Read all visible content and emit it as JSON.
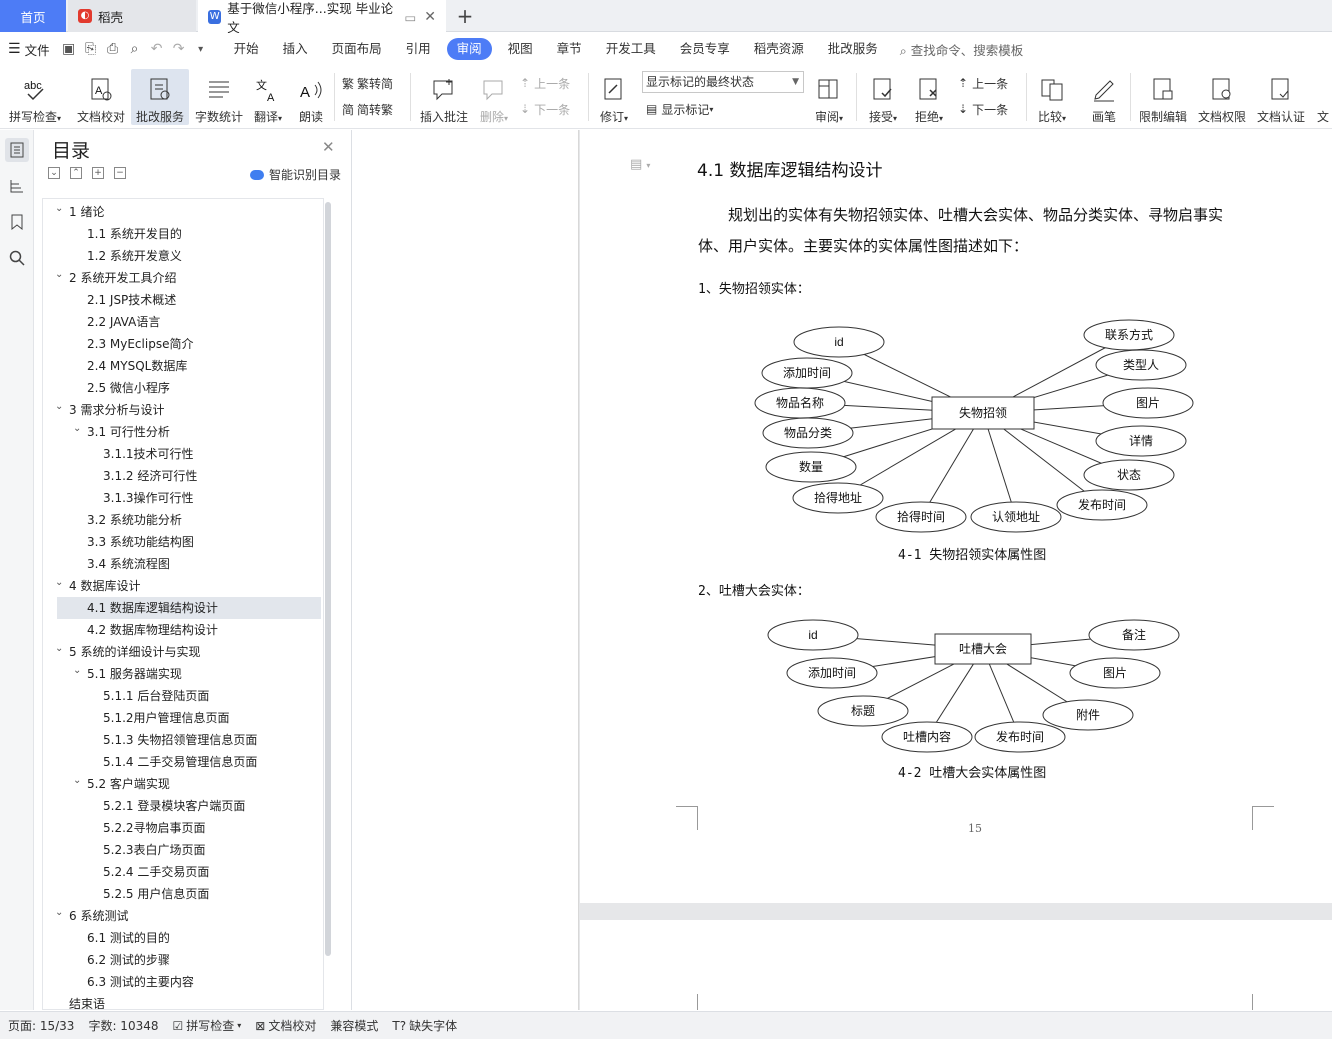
{
  "tabs": {
    "home": "首页",
    "daoke": "稻壳",
    "doc": "基于微信小程序...实现 毕业论文"
  },
  "menu": {
    "file": "文件",
    "items": [
      "开始",
      "插入",
      "页面布局",
      "引用",
      "审阅",
      "视图",
      "章节",
      "开发工具",
      "会员专享",
      "稻壳资源",
      "批改服务"
    ],
    "active": "审阅",
    "search": "查找命令、搜索模板"
  },
  "ribbon": {
    "spell": "拼写检查",
    "proof": "文档校对",
    "correct": "批改服务",
    "wordcount": "字数统计",
    "translate": "翻译",
    "read": "朗读",
    "t2s": "繁转简",
    "s2t": "简转繁",
    "add_comment": "插入批注",
    "delete": "删除",
    "prev": "上一条",
    "next": "下一条",
    "revise": "修订",
    "markup_state": "显示标记的最终状态",
    "show_markup": "显示标记",
    "review": "审阅",
    "accept": "接受",
    "reject": "拒绝",
    "prev2": "上一条",
    "next2": "下一条",
    "compare": "比较",
    "pen": "画笔",
    "restrict": "限制编辑",
    "perm": "文档权限",
    "cert": "文档认证",
    "more": "文"
  },
  "toc": {
    "title": "目录",
    "smart": "智能识别目录",
    "items": [
      {
        "label": "1  绪论",
        "level": 1,
        "arrow": "expanded"
      },
      {
        "label": "1.1  系统开发目的",
        "level": 2
      },
      {
        "label": "1.2  系统开发意义",
        "level": 2
      },
      {
        "label": "2  系统开发工具介绍",
        "level": 1,
        "arrow": "expanded"
      },
      {
        "label": "2.1 JSP技术概述",
        "level": 2
      },
      {
        "label": "2.2 JAVA语言",
        "level": 2
      },
      {
        "label": "2.3 MyEclipse简介",
        "level": 2
      },
      {
        "label": "2.4 MYSQL数据库",
        "level": 2
      },
      {
        "label": "2.5  微信小程序",
        "level": 2
      },
      {
        "label": "3  需求分析与设计",
        "level": 1,
        "arrow": "expanded"
      },
      {
        "label": "3.1  可行性分析",
        "level": 2,
        "arrow": "expanded"
      },
      {
        "label": "3.1.1技术可行性",
        "level": 3
      },
      {
        "label": "3.1.2  经济可行性",
        "level": 3
      },
      {
        "label": "3.1.3操作可行性",
        "level": 3
      },
      {
        "label": "3.2  系统功能分析",
        "level": 2
      },
      {
        "label": "3.3  系统功能结构图",
        "level": 2
      },
      {
        "label": "3.4  系统流程图",
        "level": 2
      },
      {
        "label": "4  数据库设计",
        "level": 1,
        "arrow": "expanded"
      },
      {
        "label": "4.1  数据库逻辑结构设计",
        "level": 2,
        "current": true
      },
      {
        "label": "4.2  数据库物理结构设计",
        "level": 2
      },
      {
        "label": "5  系统的详细设计与实现",
        "level": 1,
        "arrow": "expanded"
      },
      {
        "label": "5.1  服务器端实现",
        "level": 2,
        "arrow": "expanded"
      },
      {
        "label": "5.1.1  后台登陆页面",
        "level": 3
      },
      {
        "label": "5.1.2用户管理信息页面",
        "level": 3
      },
      {
        "label": "5.1.3  失物招领管理信息页面",
        "level": 3
      },
      {
        "label": "5.1.4  二手交易管理信息页面",
        "level": 3
      },
      {
        "label": "5.2  客户端实现",
        "level": 2,
        "arrow": "expanded"
      },
      {
        "label": "5.2.1  登录模块客户端页面",
        "level": 3
      },
      {
        "label": "5.2.2寻物启事页面",
        "level": 3
      },
      {
        "label": "5.2.3表白广场页面",
        "level": 3
      },
      {
        "label": "5.2.4  二手交易页面",
        "level": 3
      },
      {
        "label": "5.2.5  用户信息页面",
        "level": 3
      },
      {
        "label": "6  系统测试",
        "level": 1,
        "arrow": "expanded"
      },
      {
        "label": "6.1  测试的目的",
        "level": 2
      },
      {
        "label": "6.2  测试的步骤",
        "level": 2
      },
      {
        "label": "6.3  测试的主要内容",
        "level": 2
      },
      {
        "label": "结束语",
        "level": 1
      }
    ]
  },
  "doc": {
    "heading": "4.1  数据库逻辑结构设计",
    "para1": "规划出的实体有失物招领实体、吐槽大会实体、物品分类实体、寻物启事实",
    "para2": "体、用户实体。主要实体的实体属性图描述如下：",
    "sub1": "1、失物招领实体：",
    "sub2": "2、吐槽大会实体：",
    "cap1": "4-1 失物招领实体属性图",
    "cap2": "4-2 吐槽大会实体属性图",
    "pagenum": "15",
    "er1": {
      "entity": "失物招领",
      "attrs": [
        "id",
        "添加时间",
        "物品名称",
        "物品分类",
        "数量",
        "拾得地址",
        "拾得时间",
        "认领地址",
        "发布时间",
        "状态",
        "详情",
        "图片",
        "类型人",
        "联系方式"
      ]
    },
    "er2": {
      "entity": "吐槽大会",
      "attrs": [
        "id",
        "添加时间",
        "标题",
        "吐槽内容",
        "发布时间",
        "附件",
        "图片",
        "备注"
      ]
    }
  },
  "status": {
    "page": "页面: 15/33",
    "words": "字数: 10348",
    "spell": "拼写检查",
    "proof": "文档校对",
    "compat": "兼容模式",
    "font": "缺失字体"
  }
}
